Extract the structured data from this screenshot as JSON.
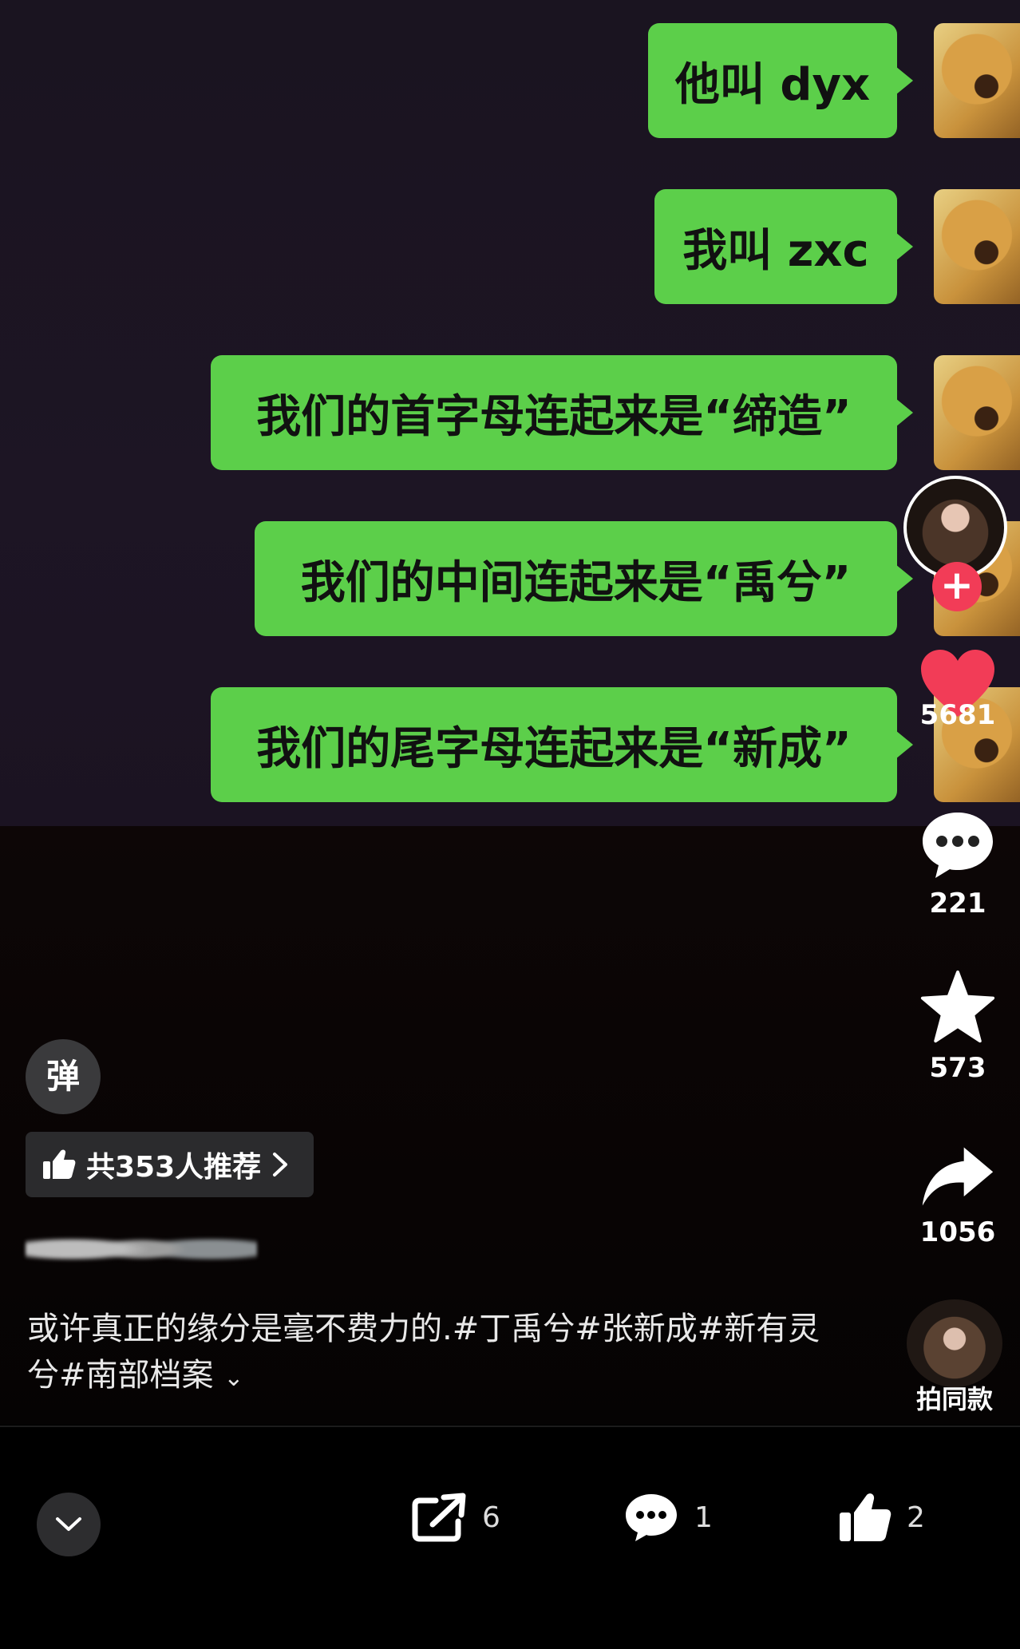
{
  "chat": {
    "messages": [
      {
        "text": "他叫 dyx"
      },
      {
        "text": "我叫 zxc"
      },
      {
        "text": "我们的首字母连起来是“缔造”"
      },
      {
        "text": "我们的中间连起来是“禹兮”"
      },
      {
        "text": "我们的尾字母连起来是“新成”"
      }
    ]
  },
  "rail": {
    "likes": "5681",
    "comments": "221",
    "favorites": "573",
    "shares": "1056",
    "follow_symbol": "+"
  },
  "danmu_label": "弹",
  "recommend_label": "共353人推荐",
  "caption_text": "或许真正的缘分是毫不费力的.#丁禹兮#张新成#新有灵兮#南部档案",
  "same_style_label": "拍同款",
  "bottom_bar": {
    "share_count": "6",
    "comment_count": "1",
    "like_count": "2"
  },
  "colors": {
    "bubble_green": "#5ccf4a",
    "like_red": "#f23c57"
  }
}
